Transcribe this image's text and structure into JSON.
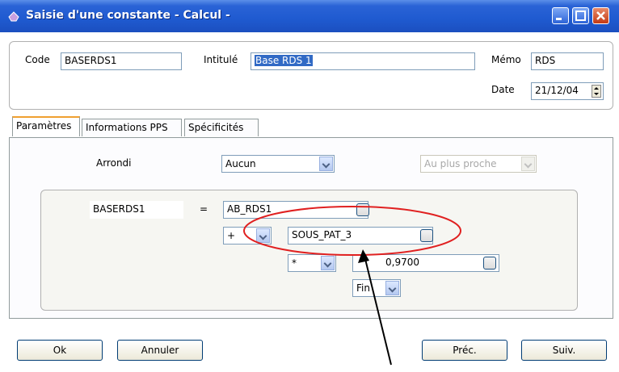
{
  "window": {
    "title": "Saisie d'une constante - Calcul -"
  },
  "header": {
    "code_label": "Code",
    "code_value": "BASERDS1",
    "intitule_label": "Intitulé",
    "intitule_value": "Base RDS 1",
    "memo_label": "Mémo",
    "memo_value": "RDS",
    "date_label": "Date",
    "date_value": "21/12/04"
  },
  "tabs": [
    {
      "label": "Paramètres"
    },
    {
      "label": "Informations PPS"
    },
    {
      "label": "Spécificités"
    }
  ],
  "parametres": {
    "arrondi_label": "Arrondi",
    "arrondi_value": "Aucun",
    "arrondi_mode_value": "Au plus proche",
    "formula": {
      "target": "BASERDS1",
      "equals": "=",
      "term1": "AB_RDS1",
      "op2": "+",
      "term2": "SOUS_PAT_3",
      "op3": "*",
      "term3": "0,9700",
      "end": "Fin"
    }
  },
  "buttons": {
    "ok": "Ok",
    "cancel": "Annuler",
    "prev": "Préc.",
    "next": "Suiv."
  },
  "colors": {
    "titlebar": "#2a63d6",
    "selection": "#316ac5",
    "annotation_ellipse": "#e02020",
    "active_tab": "#f0a030"
  }
}
